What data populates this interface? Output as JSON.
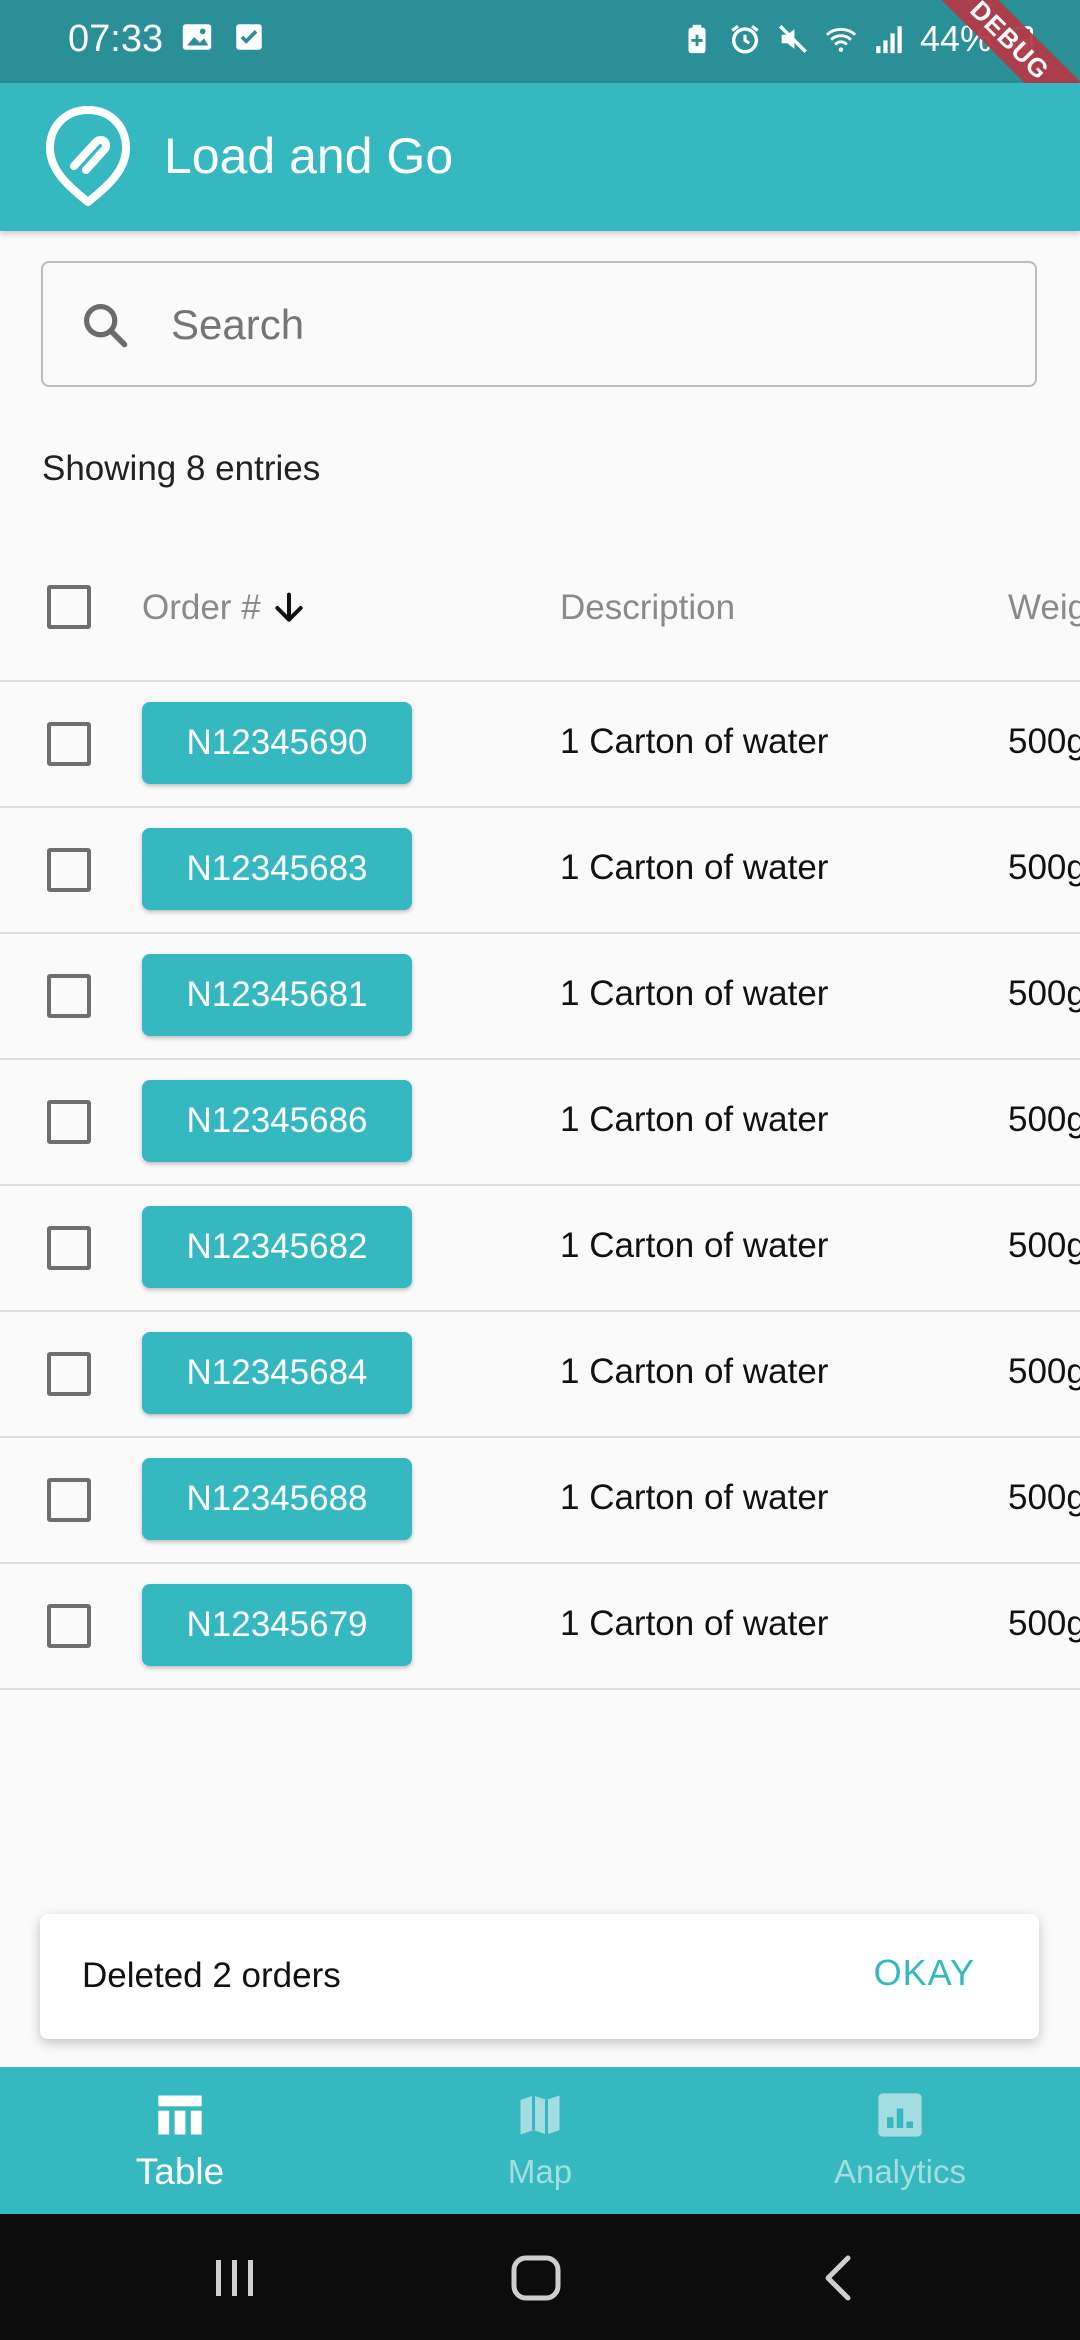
{
  "status_bar": {
    "time": "07:33",
    "battery": "44%",
    "debug_banner": "DEBUG"
  },
  "app_bar": {
    "title": "Load and Go"
  },
  "search": {
    "placeholder": "Search",
    "value": ""
  },
  "entries_text": "Showing 8 entries",
  "table": {
    "columns": [
      "Order #",
      "Description",
      "Weig"
    ],
    "sort": {
      "column": "Order #",
      "direction": "descending"
    },
    "rows": [
      {
        "order": "N12345690",
        "description": "1 Carton of water",
        "weight": "500g"
      },
      {
        "order": "N12345683",
        "description": "1 Carton of water",
        "weight": "500g"
      },
      {
        "order": "N12345681",
        "description": "1 Carton of water",
        "weight": "500g"
      },
      {
        "order": "N12345686",
        "description": "1 Carton of water",
        "weight": "500g"
      },
      {
        "order": "N12345682",
        "description": "1 Carton of water",
        "weight": "500g"
      },
      {
        "order": "N12345684",
        "description": "1 Carton of water",
        "weight": "500g"
      },
      {
        "order": "N12345688",
        "description": "1 Carton of water",
        "weight": "500g"
      },
      {
        "order": "N12345679",
        "description": "1 Carton of water",
        "weight": "500g"
      }
    ]
  },
  "snackbar": {
    "message": "Deleted 2 orders",
    "action": "OKAY"
  },
  "bottom_nav": {
    "items": [
      {
        "label": "Table",
        "icon": "table-icon",
        "active": true
      },
      {
        "label": "Map",
        "icon": "map-icon",
        "active": false
      },
      {
        "label": "Analytics",
        "icon": "analytics-icon",
        "active": false
      }
    ]
  },
  "colors": {
    "primary": "#35b8bf",
    "status_bar": "#2a8f96",
    "nav_inactive": "#a4dde0",
    "debug_ribbon": "#b23a48"
  }
}
